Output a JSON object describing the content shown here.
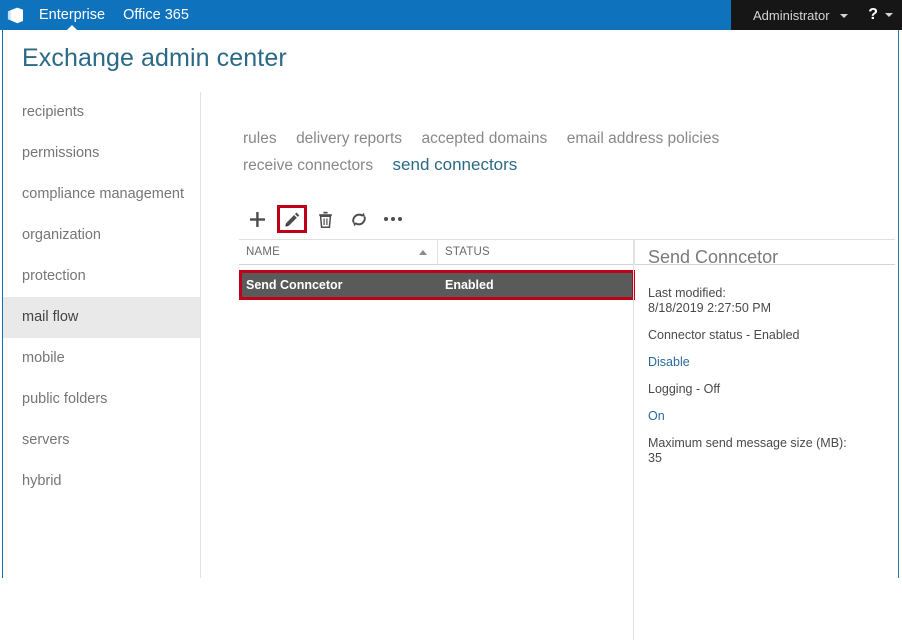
{
  "suite_bar": {
    "logo_icon": "office-logo-icon",
    "links": [
      {
        "label": "Enterprise",
        "active": true
      },
      {
        "label": "Office 365",
        "active": false
      }
    ],
    "user_label": "Administrator",
    "user_caret_icon": "chevron-down-icon",
    "help_label": "?",
    "help_caret_icon": "chevron-down-icon",
    "bar_color": "#0f72bd",
    "right_color": "#161616"
  },
  "header": {
    "title": "Exchange admin center",
    "title_color": "#2a6a86"
  },
  "sidebar": {
    "items": [
      {
        "label": "recipients",
        "selected": false
      },
      {
        "label": "permissions",
        "selected": false
      },
      {
        "label": "compliance management",
        "selected": false
      },
      {
        "label": "organization",
        "selected": false
      },
      {
        "label": "protection",
        "selected": false
      },
      {
        "label": "mail flow",
        "selected": true
      },
      {
        "label": "mobile",
        "selected": false
      },
      {
        "label": "public folders",
        "selected": false
      },
      {
        "label": "servers",
        "selected": false
      },
      {
        "label": "hybrid",
        "selected": false
      }
    ],
    "selected_bg": "#e9e9e9"
  },
  "tabs": [
    {
      "label": "rules",
      "active": false
    },
    {
      "label": "delivery reports",
      "active": false
    },
    {
      "label": "accepted domains",
      "active": false
    },
    {
      "label": "email address policies",
      "active": false
    },
    {
      "label": "receive connectors",
      "active": false
    },
    {
      "label": "send connectors",
      "active": true
    }
  ],
  "toolbar": {
    "buttons": [
      {
        "icon": "plus-icon",
        "name": "add-button",
        "highlighted": false
      },
      {
        "icon": "pencil-icon",
        "name": "edit-button",
        "highlighted": true
      },
      {
        "icon": "trash-icon",
        "name": "delete-button",
        "highlighted": false
      },
      {
        "icon": "refresh-icon",
        "name": "refresh-button",
        "highlighted": false
      },
      {
        "icon": "ellipsis-icon",
        "name": "more-options-button",
        "highlighted": false
      }
    ],
    "highlight_color": "#c00018"
  },
  "table": {
    "columns": [
      {
        "label": "NAME",
        "sort": "ascending"
      },
      {
        "label": "STATUS",
        "sort": ""
      }
    ],
    "rows": [
      {
        "name": "Send Conncetor",
        "status": "Enabled",
        "selected": true
      }
    ],
    "selected_row_bg": "#5a5a5a",
    "highlight_color": "#c00018"
  },
  "details": {
    "title": "Send Conncetor",
    "last_modified_label": "Last modified:",
    "last_modified_value": "8/18/2019 2:27:50 PM",
    "connector_status": "Connector status - Enabled",
    "disable_link": "Disable",
    "logging_status": "Logging - Off",
    "logging_on_link": "On",
    "max_size_label": "Maximum send message size (MB):",
    "max_size_value": "35",
    "link_color": "#2a6a9e"
  }
}
